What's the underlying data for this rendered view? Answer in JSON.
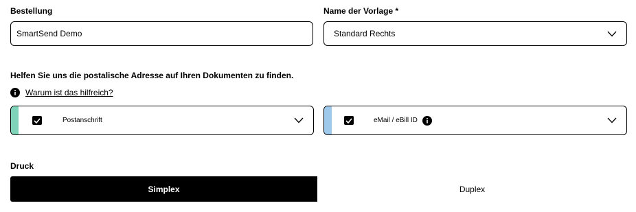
{
  "order": {
    "label": "Bestellung",
    "value": "SmartSend Demo"
  },
  "template": {
    "label": "Name der Vorlage *",
    "selected": "Standard Rechts"
  },
  "address_help": {
    "heading": "Helfen Sie uns die postalische Adresse auf Ihren Dokumenten zu finden.",
    "link": "Warum ist das hilfreich?",
    "icon": "info-icon"
  },
  "address_options": [
    {
      "label": "Postanschrift",
      "checked": true,
      "accent_color": "#7fd3b8",
      "icon": "chevron-down-icon"
    },
    {
      "label": "eMail / eBill ID",
      "checked": true,
      "accent_color": "#9ec9ea",
      "info_icon": "info-icon",
      "icon": "chevron-down-icon"
    }
  ],
  "print": {
    "label": "Druck",
    "options": [
      "Simplex",
      "Duplex"
    ],
    "selected": "Simplex"
  },
  "colors": {
    "text": "#000000",
    "background": "#ffffff",
    "selected_segment": "#000000"
  }
}
